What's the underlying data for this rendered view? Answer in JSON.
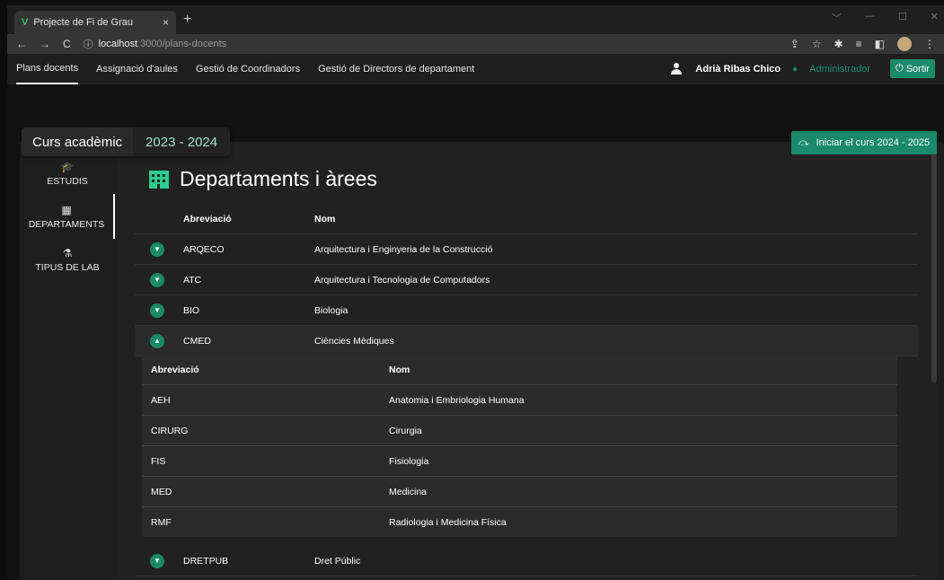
{
  "browser": {
    "tab_title": "Projecte de Fi de Grau",
    "favicon": "V",
    "close_tab": "×",
    "new_tab": "+",
    "window_controls": [
      "﹀",
      "—",
      "☐",
      "✕"
    ],
    "url_icon": "ⓘ",
    "url_host": "localhost",
    "url_path": ":3000/plans-docents",
    "nav": {
      "back": "←",
      "forward": "→",
      "reload": "C"
    },
    "tools": [
      "⇪",
      "☆",
      "✱",
      "≡",
      "◧",
      "⋮"
    ]
  },
  "appnav": {
    "items": [
      "Plans docents",
      "Assignació d'aules",
      "Gestió de Coordinadors",
      "Gestió de Directors de departament"
    ],
    "user_name": "Adrià Ribas Chico",
    "role": "Administrador",
    "logout_label": "Sortir",
    "logout_icon": "⏻"
  },
  "course": {
    "label": "Curs acadèmic",
    "value": "2023 - 2024",
    "start_button": "Iniciar el curs 2024 - 2025"
  },
  "sidebar": {
    "items": [
      {
        "icon": "graduation-cap-icon",
        "glyph": "🎓",
        "label": "ESTUDIS"
      },
      {
        "icon": "building-icon",
        "glyph": "▦",
        "label": "DEPARTAMENTS"
      },
      {
        "icon": "flask-icon",
        "glyph": "⚗",
        "label": "TIPUS DE LAB"
      }
    ]
  },
  "main": {
    "title": "Departaments i àrees",
    "columns": {
      "abbr": "Abreviació",
      "name": "Nom"
    },
    "rows": [
      {
        "abbr": "ARQECO",
        "name": "Arquitectura i Enginyeria de la Construcció"
      },
      {
        "abbr": "ATC",
        "name": "Arquitectura i Tecnologia de Computadors"
      },
      {
        "abbr": "BIO",
        "name": "Biologia"
      },
      {
        "abbr": "CMED",
        "name": "Ciències Mèdiques"
      },
      {
        "abbr": "DRETPUB",
        "name": "Dret Públic"
      }
    ],
    "subtable": {
      "columns": {
        "abbr": "Abreviació",
        "name": "Nom"
      },
      "rows": [
        {
          "abbr": "AEH",
          "name": "Anatomia i Embriologia Humana"
        },
        {
          "abbr": "CIRURG",
          "name": "Cirurgia"
        },
        {
          "abbr": "FIS",
          "name": "Fisiologia"
        },
        {
          "abbr": "MED",
          "name": "Medicina"
        },
        {
          "abbr": "RMF",
          "name": "Radiologia i Medicina Física"
        }
      ]
    }
  },
  "colors": {
    "accent": "#1a8a6a",
    "accent_light": "#2ecc8f",
    "background": "#121212"
  }
}
